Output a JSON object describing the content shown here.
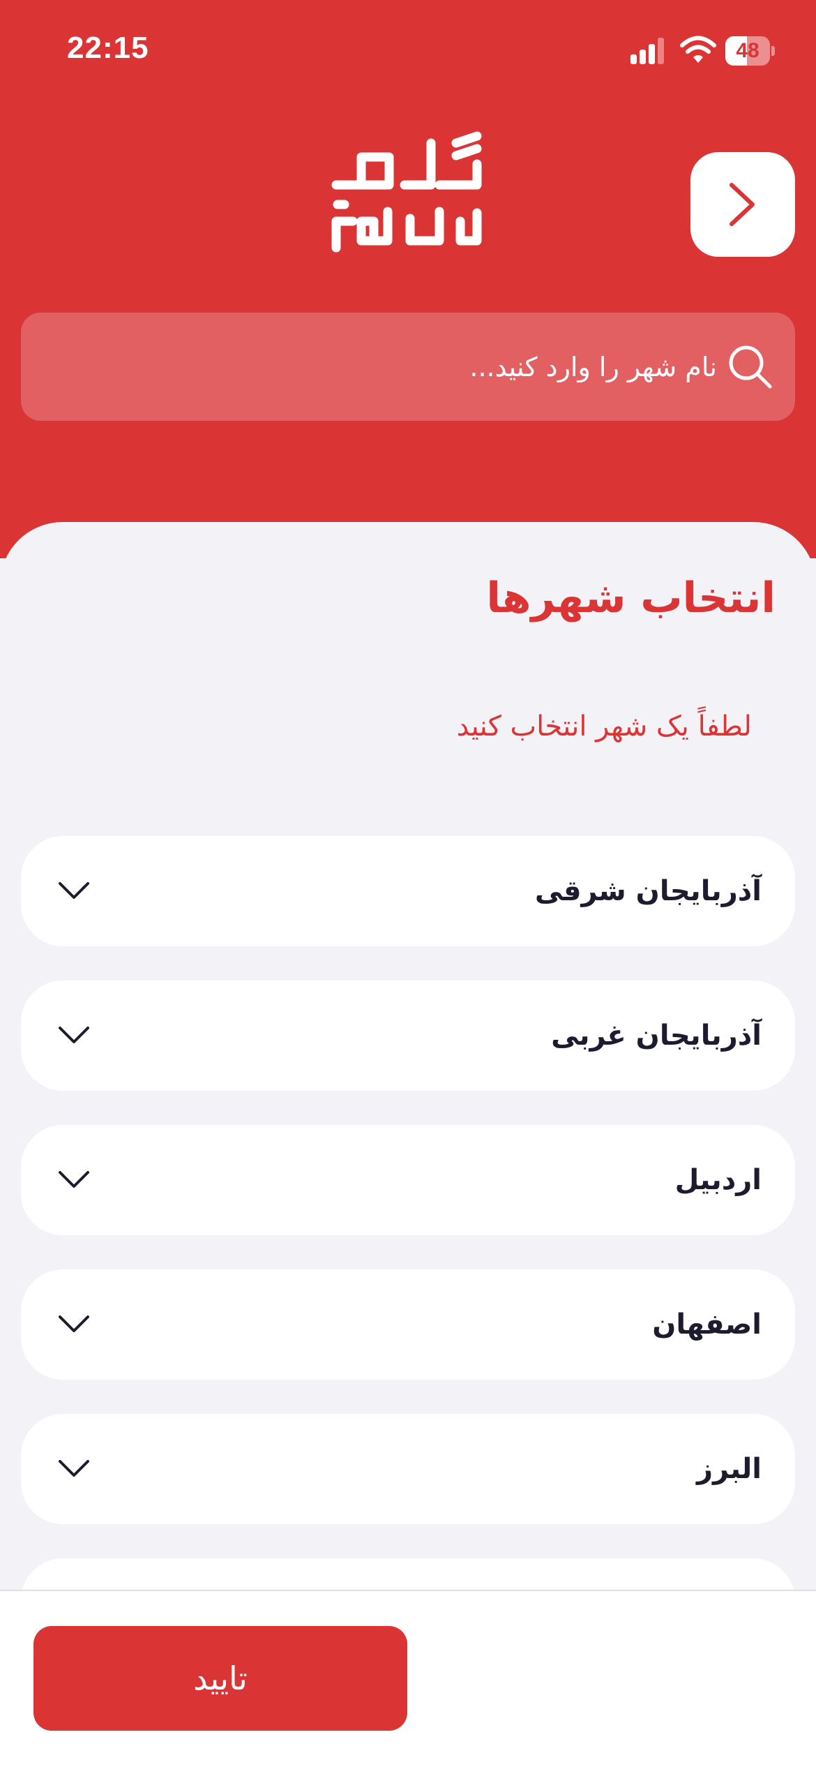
{
  "status_bar": {
    "time": "22:15",
    "battery_level": "48",
    "battery_fraction": 0.48
  },
  "header": {
    "logo_line1": "گلام",
    "logo_line2": "فایند",
    "back_icon": "chevron-right-icon"
  },
  "search": {
    "placeholder": "نام شهر را وارد کنید...",
    "value": "",
    "icon": "search-icon"
  },
  "main": {
    "title": "انتخاب شهرها",
    "subtitle": "لطفاً یک شهر انتخاب کنید"
  },
  "provinces": [
    {
      "name": "آذربایجان شرقی"
    },
    {
      "name": "آذربایجان غربی"
    },
    {
      "name": "اردبیل"
    },
    {
      "name": "اصفهان"
    },
    {
      "name": "البرز"
    },
    {
      "name": ""
    }
  ],
  "footer": {
    "confirm_label": "تایید"
  },
  "colors": {
    "accent": "#DA3435",
    "background": "#F2F2F7",
    "text_dark": "#1C1C2E"
  }
}
